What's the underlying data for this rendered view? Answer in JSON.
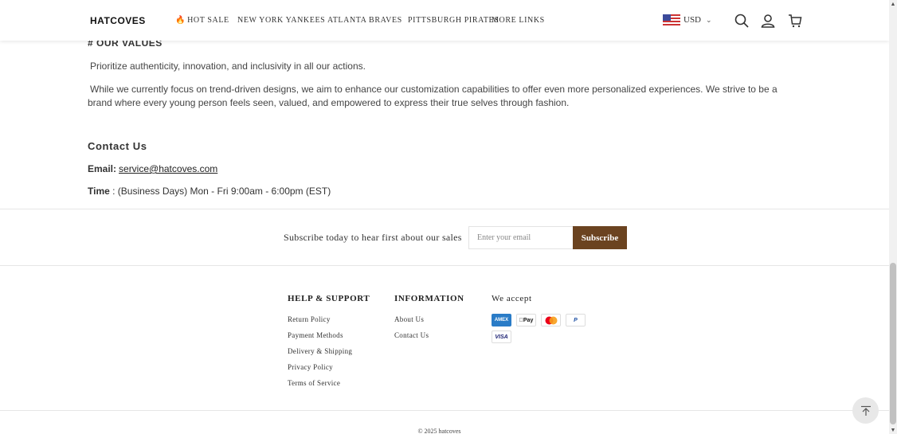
{
  "header": {
    "logo": "HATCOVES",
    "nav": [
      {
        "label": "HOT SALE",
        "icon": "flame-icon"
      },
      {
        "label": "NEW YORK YANKEES"
      },
      {
        "label": "ATLANTA BRAVES"
      },
      {
        "label": "PITTSBURGH PIRATES"
      },
      {
        "label": "MORE LINKS"
      }
    ],
    "currency": "USD",
    "icons": [
      "search-icon",
      "user-icon",
      "cart-icon"
    ]
  },
  "values": {
    "title": "# OUR VALUES",
    "p1": "Prioritize authenticity, innovation, and inclusivity in all our actions.",
    "p2": "While we currently focus on trend-driven designs, we aim to enhance our customization capabilities to offer even more personalized experiences. We strive to be a brand where every young person feels seen, valued, and empowered to express their true selves through fashion."
  },
  "contact": {
    "title": "Contact Us",
    "email_label": "Email:",
    "email": "service@hatcoves.com",
    "time_label": "Time",
    "time_value": ": (Business Days) Mon - Fri 9:00am - 6:00pm (EST)"
  },
  "subscribe": {
    "text": "Subscribe today to hear first about our sales",
    "placeholder": "Enter your email",
    "button": "Subscribe"
  },
  "footer": {
    "help": {
      "title": "HELP & SUPPORT",
      "links": [
        "Return Policy",
        "Payment Methods",
        "Delivery & Shipping",
        "Privacy Policy",
        "Terms of Service"
      ]
    },
    "information": {
      "title": "INFORMATION",
      "links": [
        "About Us",
        "Contact Us"
      ]
    },
    "accept": {
      "title": "We accept",
      "methods": [
        "AMEX",
        "Pay",
        "",
        "P",
        "VISA"
      ]
    },
    "copyright": "© 2025 hatcoves"
  },
  "colors": {
    "brand": "#6b4320",
    "hot": "#e8732a"
  }
}
